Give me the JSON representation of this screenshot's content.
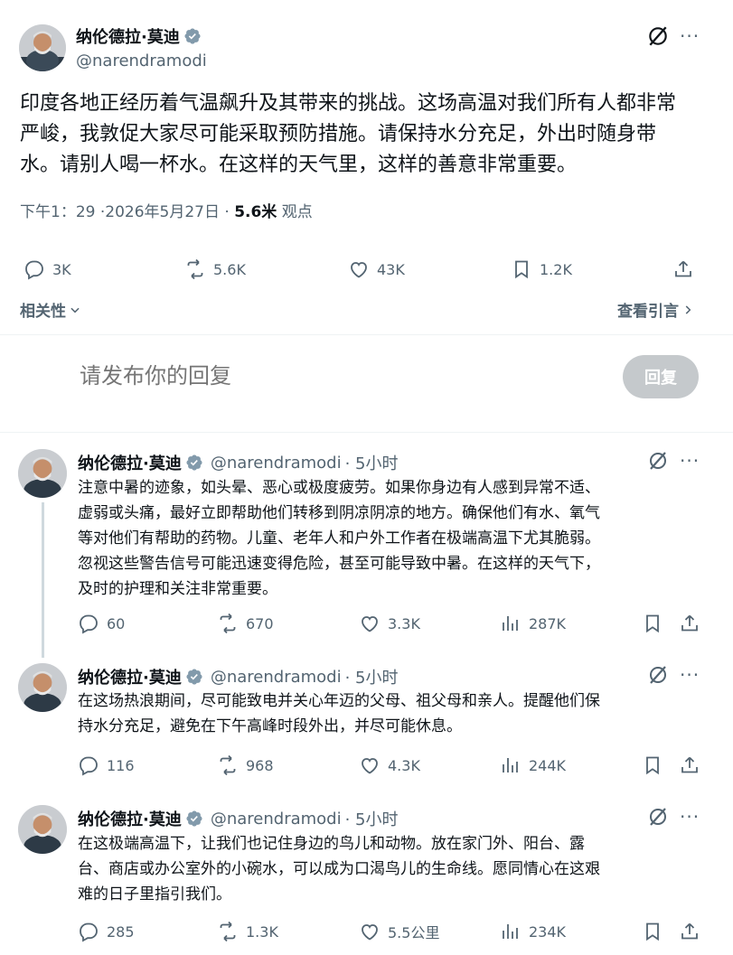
{
  "post": {
    "author_name": "纳伦德拉·莫迪",
    "handle": "@narendramodi",
    "text_lines": [
      "印度各地正经历着气温飙升及其带来的挑战。这场高温对我们所有人都非常",
      "严峻，我敦促大家尽可能采取预防措施。请保持水分充足，外出时随身带",
      "水。请别人喝一杯水。在这样的天气里，这样的善意非常重要。"
    ],
    "timestamp": "下午1：29 ·2026年5月27日 ·",
    "views_count": "5.6米",
    "views_label": "观点",
    "replies": "3K",
    "reposts": "5.6K",
    "likes": "43K",
    "bookmarks": "1.2K"
  },
  "sort": {
    "label": "相关性"
  },
  "quotes_link": "查看引言",
  "composer": {
    "placeholder": "请发布你的回复",
    "button": "回复"
  },
  "replies": [
    {
      "author_name": "纳伦德拉·莫迪",
      "handle": "@narendramodi",
      "time": "· 5小时",
      "text_lines": [
        "注意中暑的迹象，如头晕、恶心或极度疲劳。如果你身边有人感到异常不适、",
        "虚弱或头痛，最好立即帮助他们转移到阴凉阴凉的地方。确保他们有水、氧气",
        "等对他们有帮助的药物。儿童、老年人和户外工作者在极端高温下尤其脆弱。",
        "忽视这些警告信号可能迅速变得危险，甚至可能导致中暑。在这样的天气下，",
        "及时的护理和关注非常重要。"
      ],
      "replies": "60",
      "reposts": "670",
      "likes": "3.3K",
      "views": "287K"
    },
    {
      "author_name": "纳伦德拉·莫迪",
      "handle": "@narendramodi",
      "time": "· 5小时",
      "text_lines": [
        "在这场热浪期间，尽可能致电并关心年迈的父母、祖父母和亲人。提醒他们保",
        "持水分充足，避免在下午高峰时段外出，并尽可能休息。"
      ],
      "replies": "116",
      "reposts": "968",
      "likes": "4.3K",
      "views": "244K"
    },
    {
      "author_name": "纳伦德拉·莫迪",
      "handle": "@narendramodi",
      "time": "· 5小时",
      "text_lines": [
        "在这极端高温下，让我们也记住身边的鸟儿和动物。放在家门外、阳台、露",
        "台、商店或办公室外的小碗水，可以成为口渴鸟儿的生命线。愿同情心在这艰",
        "难的日子里指引我们。"
      ],
      "replies": "285",
      "reposts": "1.3K",
      "likes": "5.5公里",
      "views": "234K"
    }
  ],
  "colors": {
    "verified": "#829aab",
    "muted": "#536471",
    "text": "#0f1419",
    "divider": "#eff3f4"
  },
  "icons": [
    "grok-icon",
    "more-icon",
    "reply-icon",
    "repost-icon",
    "like-icon",
    "bookmark-icon",
    "share-icon",
    "views-icon",
    "verified-icon",
    "chevron-down-icon",
    "chevron-right-icon"
  ]
}
